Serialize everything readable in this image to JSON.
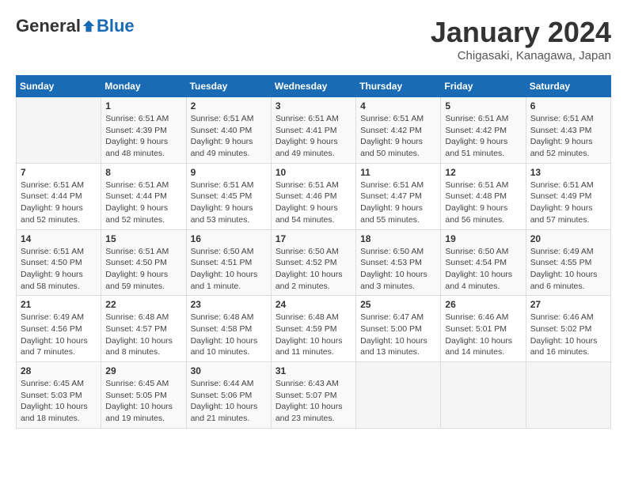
{
  "header": {
    "logo": {
      "general": "General",
      "blue": "Blue"
    },
    "title": "January 2024",
    "subtitle": "Chigasaki, Kanagawa, Japan"
  },
  "weekdays": [
    "Sunday",
    "Monday",
    "Tuesday",
    "Wednesday",
    "Thursday",
    "Friday",
    "Saturday"
  ],
  "weeks": [
    [
      {
        "day": "",
        "info": ""
      },
      {
        "day": "1",
        "info": "Sunrise: 6:51 AM\nSunset: 4:39 PM\nDaylight: 9 hours\nand 48 minutes."
      },
      {
        "day": "2",
        "info": "Sunrise: 6:51 AM\nSunset: 4:40 PM\nDaylight: 9 hours\nand 49 minutes."
      },
      {
        "day": "3",
        "info": "Sunrise: 6:51 AM\nSunset: 4:41 PM\nDaylight: 9 hours\nand 49 minutes."
      },
      {
        "day": "4",
        "info": "Sunrise: 6:51 AM\nSunset: 4:42 PM\nDaylight: 9 hours\nand 50 minutes."
      },
      {
        "day": "5",
        "info": "Sunrise: 6:51 AM\nSunset: 4:42 PM\nDaylight: 9 hours\nand 51 minutes."
      },
      {
        "day": "6",
        "info": "Sunrise: 6:51 AM\nSunset: 4:43 PM\nDaylight: 9 hours\nand 52 minutes."
      }
    ],
    [
      {
        "day": "7",
        "info": ""
      },
      {
        "day": "8",
        "info": "Sunrise: 6:51 AM\nSunset: 4:44 PM\nDaylight: 9 hours\nand 52 minutes."
      },
      {
        "day": "9",
        "info": "Sunrise: 6:51 AM\nSunset: 4:45 PM\nDaylight: 9 hours\nand 53 minutes."
      },
      {
        "day": "10",
        "info": "Sunrise: 6:51 AM\nSunset: 4:46 PM\nDaylight: 9 hours\nand 54 minutes."
      },
      {
        "day": "11",
        "info": "Sunrise: 6:51 AM\nSunset: 4:47 PM\nDaylight: 9 hours\nand 55 minutes."
      },
      {
        "day": "12",
        "info": "Sunrise: 6:51 AM\nSunset: 4:48 PM\nDaylight: 9 hours\nand 56 minutes."
      },
      {
        "day": "13",
        "info": "Sunrise: 6:51 AM\nSunset: 4:49 PM\nDaylight: 9 hours\nand 57 minutes."
      }
    ],
    [
      {
        "day": "14",
        "info": "Sunrise: 6:51 AM\nSunset: 4:50 PM\nDaylight: 9 hours\nand 58 minutes."
      },
      {
        "day": "15",
        "info": "Sunrise: 6:51 AM\nSunset: 4:50 PM\nDaylight: 9 hours\nand 59 minutes."
      },
      {
        "day": "16",
        "info": "Sunrise: 6:50 AM\nSunset: 4:51 PM\nDaylight: 10 hours\nand 1 minute."
      },
      {
        "day": "17",
        "info": "Sunrise: 6:50 AM\nSunset: 4:52 PM\nDaylight: 10 hours\nand 2 minutes."
      },
      {
        "day": "18",
        "info": "Sunrise: 6:50 AM\nSunset: 4:53 PM\nDaylight: 10 hours\nand 3 minutes."
      },
      {
        "day": "19",
        "info": "Sunrise: 6:50 AM\nSunset: 4:54 PM\nDaylight: 10 hours\nand 4 minutes."
      },
      {
        "day": "20",
        "info": "Sunrise: 6:49 AM\nSunset: 4:55 PM\nDaylight: 10 hours\nand 6 minutes."
      }
    ],
    [
      {
        "day": "21",
        "info": "Sunrise: 6:49 AM\nSunset: 4:56 PM\nDaylight: 10 hours\nand 7 minutes."
      },
      {
        "day": "22",
        "info": "Sunrise: 6:48 AM\nSunset: 4:57 PM\nDaylight: 10 hours\nand 8 minutes."
      },
      {
        "day": "23",
        "info": "Sunrise: 6:48 AM\nSunset: 4:58 PM\nDaylight: 10 hours\nand 10 minutes."
      },
      {
        "day": "24",
        "info": "Sunrise: 6:48 AM\nSunset: 4:59 PM\nDaylight: 10 hours\nand 11 minutes."
      },
      {
        "day": "25",
        "info": "Sunrise: 6:47 AM\nSunset: 5:00 PM\nDaylight: 10 hours\nand 13 minutes."
      },
      {
        "day": "26",
        "info": "Sunrise: 6:46 AM\nSunset: 5:01 PM\nDaylight: 10 hours\nand 14 minutes."
      },
      {
        "day": "27",
        "info": "Sunrise: 6:46 AM\nSunset: 5:02 PM\nDaylight: 10 hours\nand 16 minutes."
      }
    ],
    [
      {
        "day": "28",
        "info": "Sunrise: 6:45 AM\nSunset: 5:03 PM\nDaylight: 10 hours\nand 18 minutes."
      },
      {
        "day": "29",
        "info": "Sunrise: 6:45 AM\nSunset: 5:05 PM\nDaylight: 10 hours\nand 19 minutes."
      },
      {
        "day": "30",
        "info": "Sunrise: 6:44 AM\nSunset: 5:06 PM\nDaylight: 10 hours\nand 21 minutes."
      },
      {
        "day": "31",
        "info": "Sunrise: 6:43 AM\nSunset: 5:07 PM\nDaylight: 10 hours\nand 23 minutes."
      },
      {
        "day": "",
        "info": ""
      },
      {
        "day": "",
        "info": ""
      },
      {
        "day": "",
        "info": ""
      }
    ]
  ]
}
